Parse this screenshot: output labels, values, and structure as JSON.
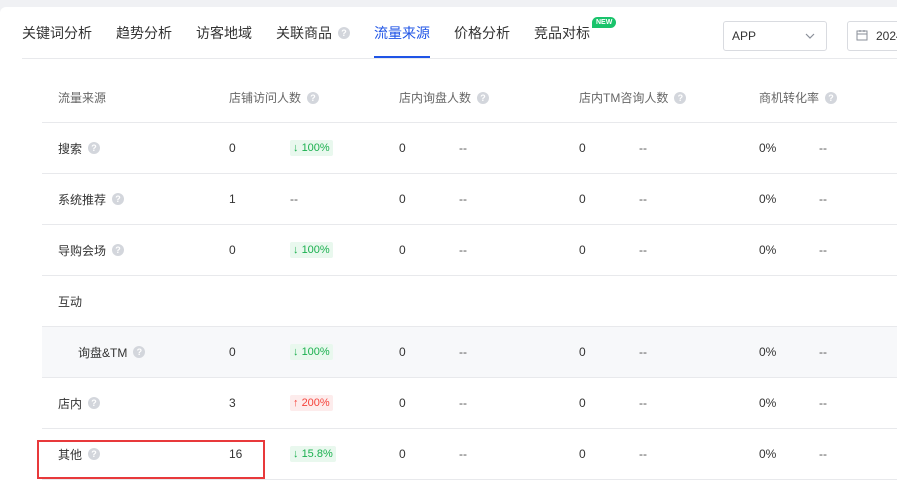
{
  "tabs": [
    {
      "label": "关键词分析",
      "active": false
    },
    {
      "label": "趋势分析",
      "active": false
    },
    {
      "label": "访客地域",
      "active": false
    },
    {
      "label": "关联商品",
      "active": false,
      "help": true
    },
    {
      "label": "流量来源",
      "active": true
    },
    {
      "label": "价格分析",
      "active": false
    },
    {
      "label": "竞品对标",
      "active": false,
      "badge": "NEW"
    }
  ],
  "filters": {
    "platform_select": {
      "value": "APP"
    },
    "date_picker": {
      "value": "2024"
    }
  },
  "table": {
    "columns": [
      "流量来源",
      "店铺访问人数",
      "店内询盘人数",
      "店内TM咨询人数",
      "商机转化率"
    ],
    "rows": [
      {
        "name": "搜索",
        "help": true,
        "indent": false,
        "v1": "0",
        "t1": "100%",
        "t1_dir": "down",
        "v2": "0",
        "t2": "--",
        "v3": "0",
        "t3": "--",
        "v4": "0%",
        "t4": "--"
      },
      {
        "name": "系统推荐",
        "help": true,
        "indent": false,
        "v1": "1",
        "t1": "--",
        "t1_dir": "none",
        "v2": "0",
        "t2": "--",
        "v3": "0",
        "t3": "--",
        "v4": "0%",
        "t4": "--"
      },
      {
        "name": "导购会场",
        "help": true,
        "indent": false,
        "v1": "0",
        "t1": "100%",
        "t1_dir": "down",
        "v2": "0",
        "t2": "--",
        "v3": "0",
        "t3": "--",
        "v4": "0%",
        "t4": "--"
      },
      {
        "name": "互动",
        "help": false,
        "indent": false,
        "group": true
      },
      {
        "name": "询盘&TM",
        "help": true,
        "indent": true,
        "v1": "0",
        "t1": "100%",
        "t1_dir": "down",
        "v2": "0",
        "t2": "--",
        "v3": "0",
        "t3": "--",
        "v4": "0%",
        "t4": "--"
      },
      {
        "name": "店内",
        "help": true,
        "indent": false,
        "v1": "3",
        "t1": "200%",
        "t1_dir": "up",
        "v2": "0",
        "t2": "--",
        "v3": "0",
        "t3": "--",
        "v4": "0%",
        "t4": "--"
      },
      {
        "name": "其他",
        "help": true,
        "indent": false,
        "v1": "16",
        "t1": "15.8%",
        "t1_dir": "down",
        "v2": "0",
        "t2": "--",
        "v3": "0",
        "t3": "--",
        "v4": "0%",
        "t4": "--"
      }
    ]
  },
  "colors": {
    "accent": "#1f54e6",
    "down": "#1bb04f",
    "up": "#f5433b",
    "highlight": "#e8393b",
    "badge": "#19c36b"
  }
}
